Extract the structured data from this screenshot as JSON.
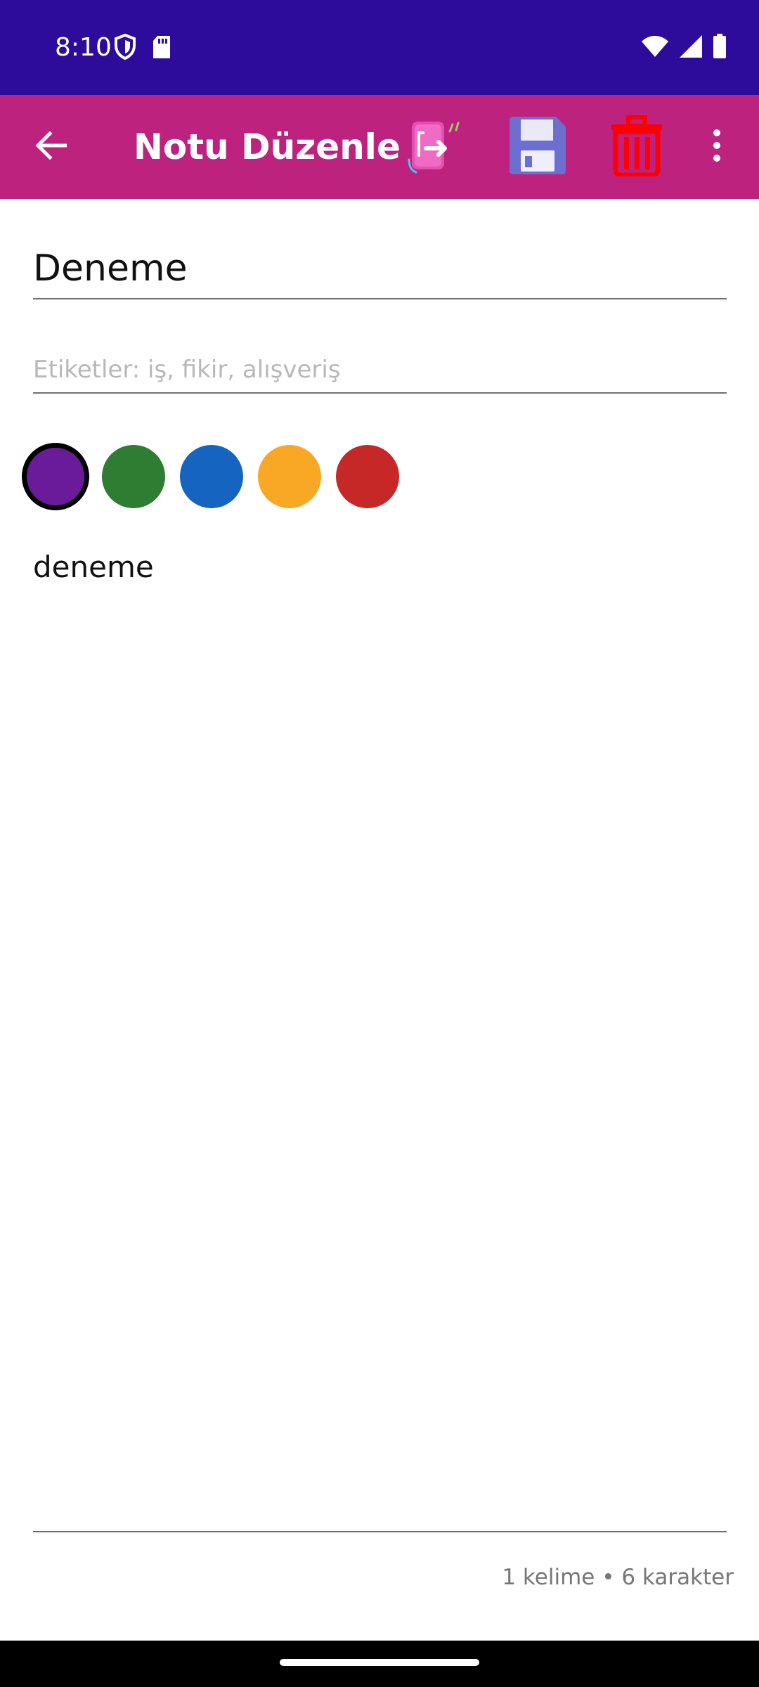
{
  "status_bar": {
    "time": "8:10",
    "icons": [
      "shield-icon",
      "sd-card-icon",
      "wifi-icon",
      "signal-icon",
      "battery-icon"
    ],
    "color": "#2e0c9b"
  },
  "app_bar": {
    "title": "Notu Düzenle",
    "color": "#bd227f",
    "actions": [
      "back-arrow-icon",
      "export-icon",
      "save-icon",
      "trash-icon",
      "more-vert-icon"
    ]
  },
  "editor": {
    "title_value": "Deneme",
    "tags_placeholder": "Etiketler: iş, fikir, alışveriş",
    "tags_value": "",
    "body_value": "deneme",
    "word_count": "1 kelime • 6 karakter"
  },
  "colors": {
    "selected": "#6a1b9a",
    "swatches": [
      "#6a1b9a",
      "#2e7d32",
      "#1565c0",
      "#f9a825",
      "#c62828"
    ]
  }
}
